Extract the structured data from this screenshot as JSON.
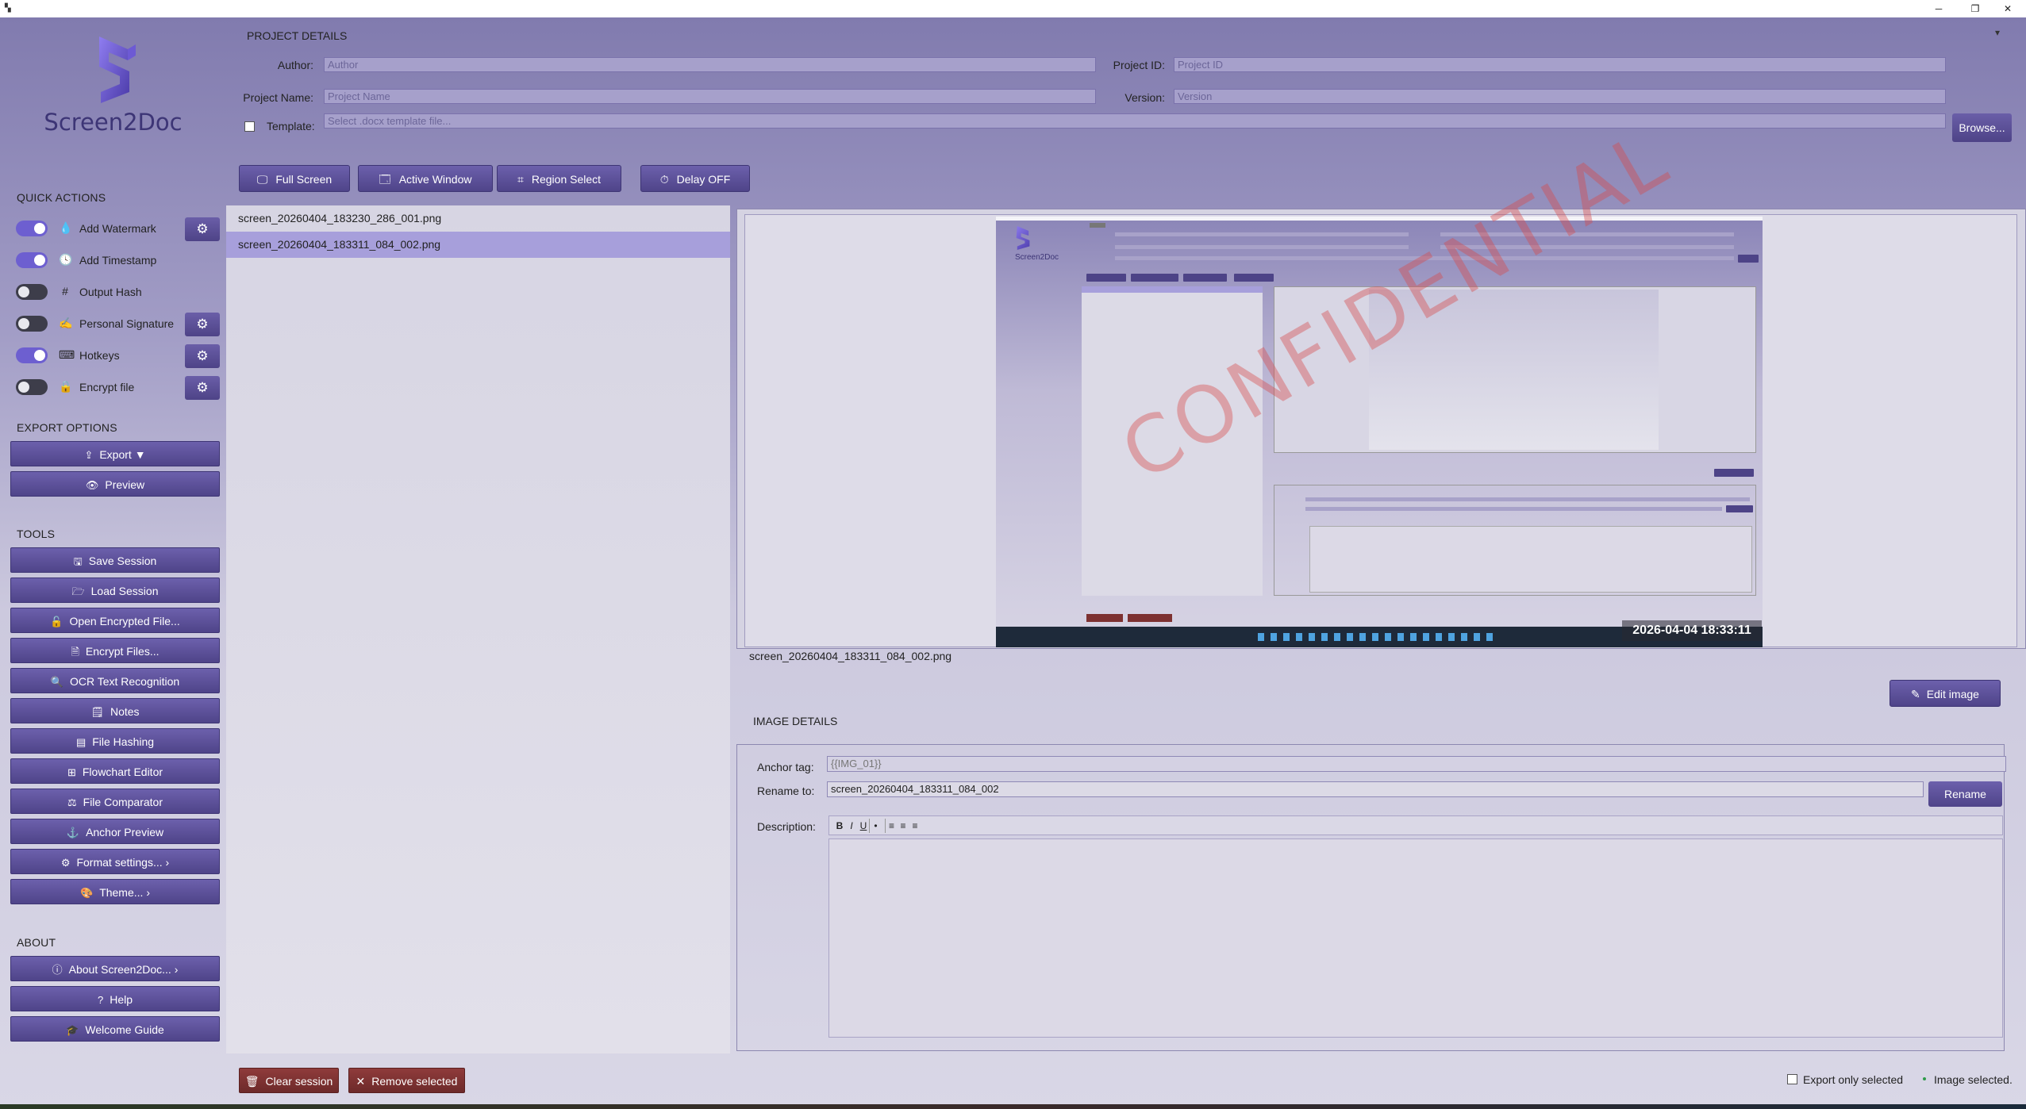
{
  "window": {
    "minimize_glyph": "─",
    "maximize_glyph": "❐",
    "close_glyph": "✕",
    "menu_glyph": "▾"
  },
  "app": {
    "name": "Screen2Doc"
  },
  "sidebar": {
    "quick_actions_title": "QUICK ACTIONS",
    "quick_actions": [
      {
        "label": "Add Watermark",
        "on": true,
        "icon": "droplet-icon",
        "glyph": "💧",
        "has_settings": true
      },
      {
        "label": "Add Timestamp",
        "on": true,
        "icon": "clock-icon",
        "glyph": "🕓",
        "has_settings": false
      },
      {
        "label": "Output Hash",
        "on": false,
        "icon": "hash-icon",
        "glyph": "#",
        "has_settings": false
      },
      {
        "label": "Personal Signature",
        "on": false,
        "icon": "signature-icon",
        "glyph": "✍",
        "has_settings": true
      },
      {
        "label": "Hotkeys",
        "on": true,
        "icon": "keyboard-icon",
        "glyph": "⌨",
        "has_settings": true
      },
      {
        "label": "Encrypt file",
        "on": false,
        "icon": "lock-icon",
        "glyph": "🔒",
        "has_settings": true
      }
    ],
    "export_title": "EXPORT OPTIONS",
    "export_label": "Export",
    "preview_label": "Preview",
    "tools_title": "TOOLS",
    "tools": [
      {
        "label": "Save Session",
        "icon": "save-icon",
        "glyph": "🖫"
      },
      {
        "label": "Load Session",
        "icon": "folder-icon",
        "glyph": "🗁"
      },
      {
        "label": "Open Encrypted File...",
        "icon": "unlock-icon",
        "glyph": "🔓"
      },
      {
        "label": "Encrypt Files...",
        "icon": "encrypt-file-icon",
        "glyph": "🗎"
      },
      {
        "label": "OCR Text Recognition",
        "icon": "magnifier-icon",
        "glyph": "🔍"
      },
      {
        "label": "Notes",
        "icon": "notes-icon",
        "glyph": "🗒"
      },
      {
        "label": "File Hashing",
        "icon": "hash-file-icon",
        "glyph": "▤"
      },
      {
        "label": "Flowchart Editor",
        "icon": "flowchart-icon",
        "glyph": "⊞"
      },
      {
        "label": "File Comparator",
        "icon": "compare-icon",
        "glyph": "⚖"
      },
      {
        "label": "Anchor Preview",
        "icon": "anchor-icon",
        "glyph": "⚓"
      },
      {
        "label": "Format settings...",
        "icon": "format-gear-icon",
        "glyph": "⚙"
      },
      {
        "label": "Theme...",
        "icon": "palette-icon",
        "glyph": "🎨"
      }
    ],
    "about_title": "ABOUT",
    "about": [
      {
        "label": "About Screen2Doc...",
        "icon": "info-icon",
        "glyph": "ⓘ"
      },
      {
        "label": "Help",
        "icon": "question-icon",
        "glyph": "?"
      },
      {
        "label": "Welcome Guide",
        "icon": "graduation-icon",
        "glyph": "🎓"
      }
    ]
  },
  "project": {
    "title": "PROJECT DETAILS",
    "author_label": "Author:",
    "author_placeholder": "Author",
    "project_id_label": "Project ID:",
    "project_id_placeholder": "Project ID",
    "project_name_label": "Project Name:",
    "project_name_placeholder": "Project Name",
    "version_label": "Version:",
    "version_placeholder": "Version",
    "template_label": "Template:",
    "template_placeholder": "Select .docx template file...",
    "browse_label": "Browse..."
  },
  "capture": {
    "full_screen": "Full Screen",
    "active_window": "Active Window",
    "region_select": "Region Select",
    "delay": "Delay OFF"
  },
  "files": [
    {
      "name": "screen_20260404_183230_286_001.png",
      "selected": false
    },
    {
      "name": "screen_20260404_183311_084_002.png",
      "selected": true
    }
  ],
  "preview": {
    "caption": "screen_20260404_183311_084_002.png",
    "watermark": "CONFIDENTIAL",
    "timestamp": "2026-04-04 18:33:11",
    "edit_label": "Edit image"
  },
  "image_details": {
    "title": "IMAGE DETAILS",
    "anchor_label": "Anchor tag:",
    "anchor_value": "{{IMG_01}}",
    "rename_label": "Rename to:",
    "rename_value": "screen_20260404_183311_084_002",
    "rename_button": "Rename",
    "description_label": "Description:",
    "toolbar": [
      "B",
      "I",
      "U",
      "•",
      "≡",
      "≡",
      "≡"
    ]
  },
  "bottom": {
    "clear_session": "Clear session",
    "remove_selected": "Remove selected",
    "export_only_label": "Export only selected",
    "status": "Image selected."
  },
  "colors": {
    "accent": "#6d5fd0",
    "button": "#5a4f98",
    "danger": "#7d3131",
    "selection": "#a79fdb"
  }
}
